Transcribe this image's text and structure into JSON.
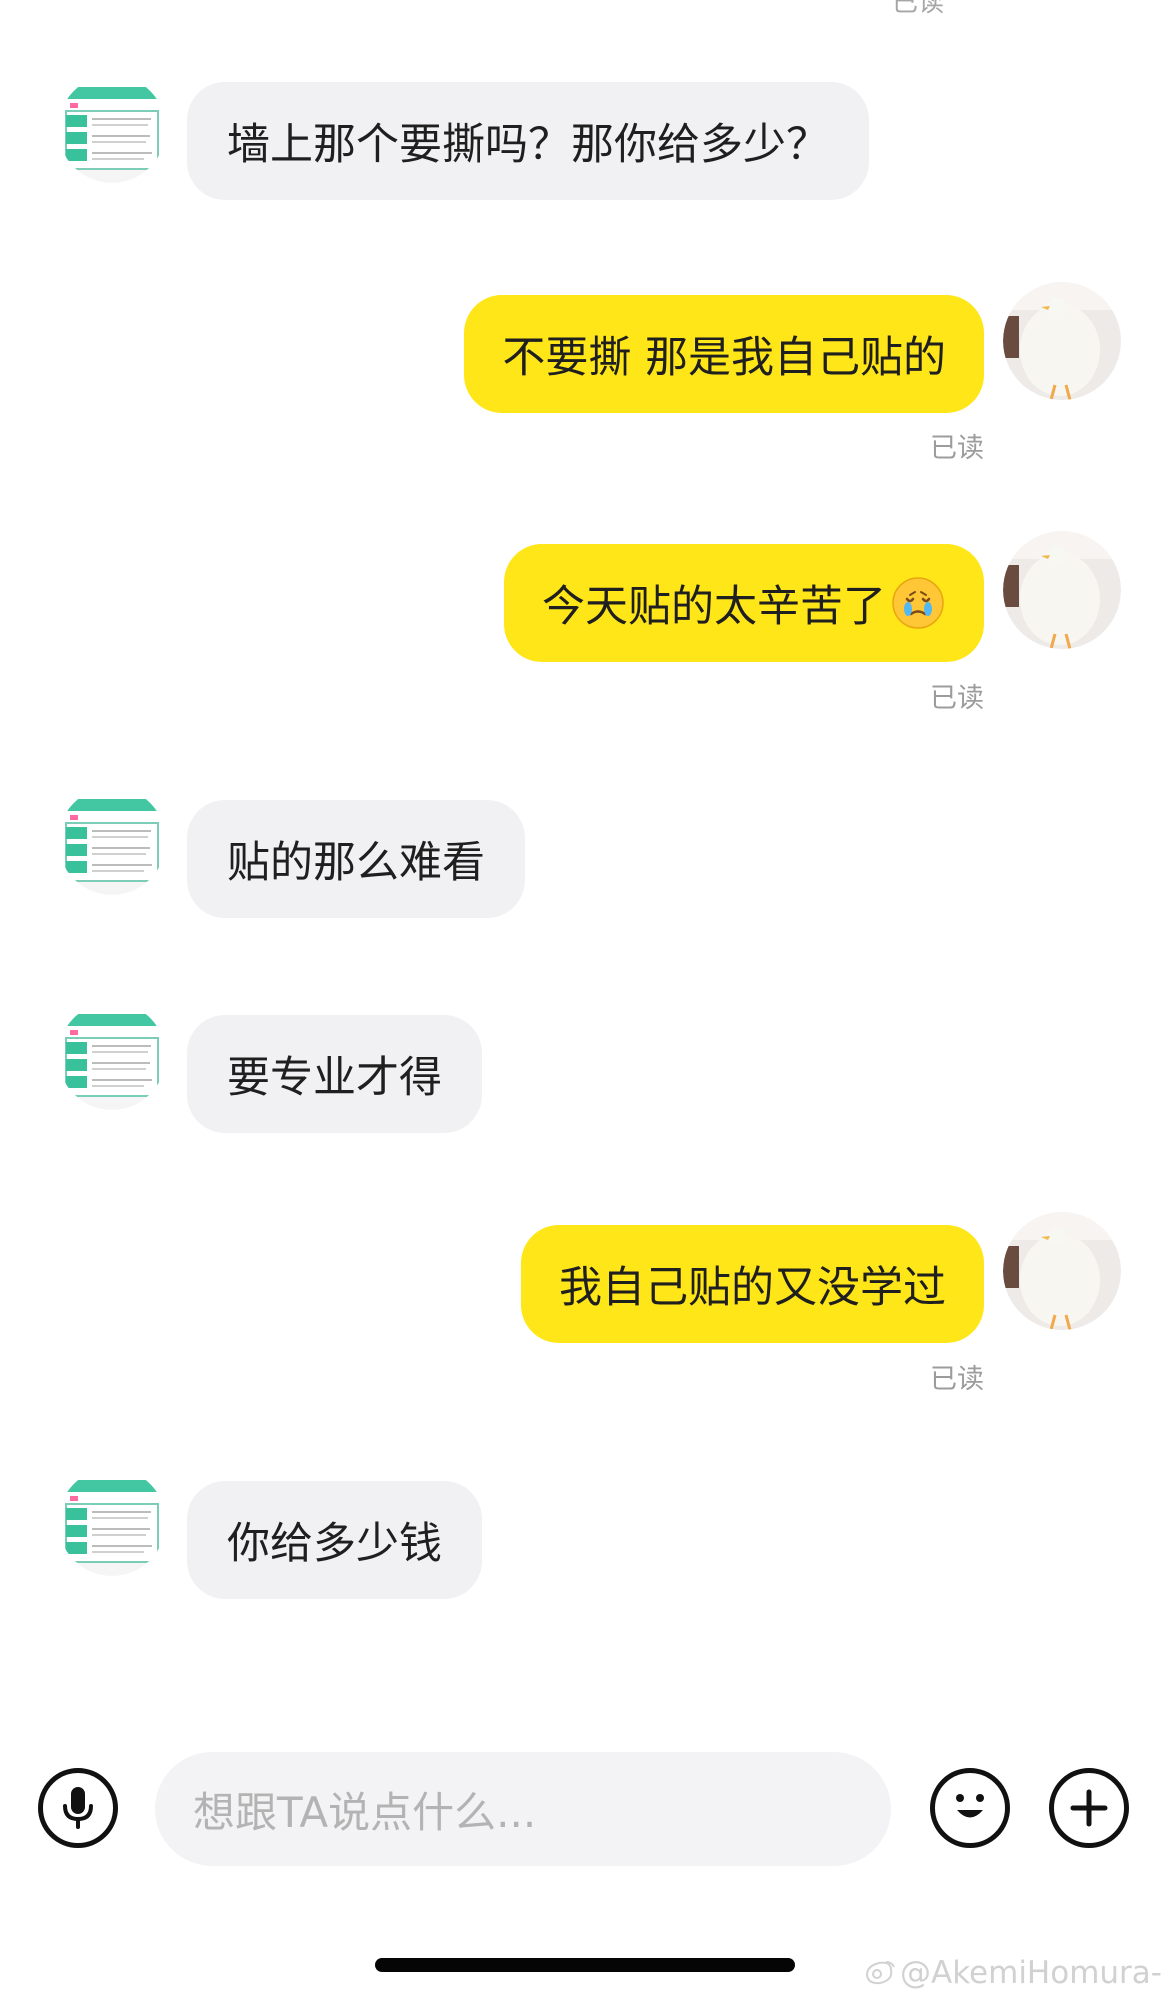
{
  "header": {
    "read_partial": "已读"
  },
  "messages": [
    {
      "side": "left",
      "text": "墙上那个要撕吗？那你给多少？"
    },
    {
      "side": "right",
      "text": "不要撕 那是我自己贴的",
      "status": "已读"
    },
    {
      "side": "right",
      "text": "今天贴的太辛苦了",
      "emoji": "crying-face",
      "status": "已读"
    },
    {
      "side": "left",
      "text": "贴的那么难看"
    },
    {
      "side": "left",
      "text": "要专业才得"
    },
    {
      "side": "right",
      "text": "我自己贴的又没学过",
      "status": "已读"
    },
    {
      "side": "left",
      "text": "你给多少钱"
    }
  ],
  "composer": {
    "placeholder": "想跟TA说点什么...",
    "voice_icon": "microphone-icon",
    "emoji_icon": "smiley-icon",
    "plus_icon": "plus-icon"
  },
  "watermark": {
    "text": "@AkemiHomura-"
  },
  "colors": {
    "left_bubble": "#f1f1f3",
    "right_bubble": "#ffe619",
    "read_text": "#9c9c9c",
    "avatar_left": "#45c8a6"
  }
}
